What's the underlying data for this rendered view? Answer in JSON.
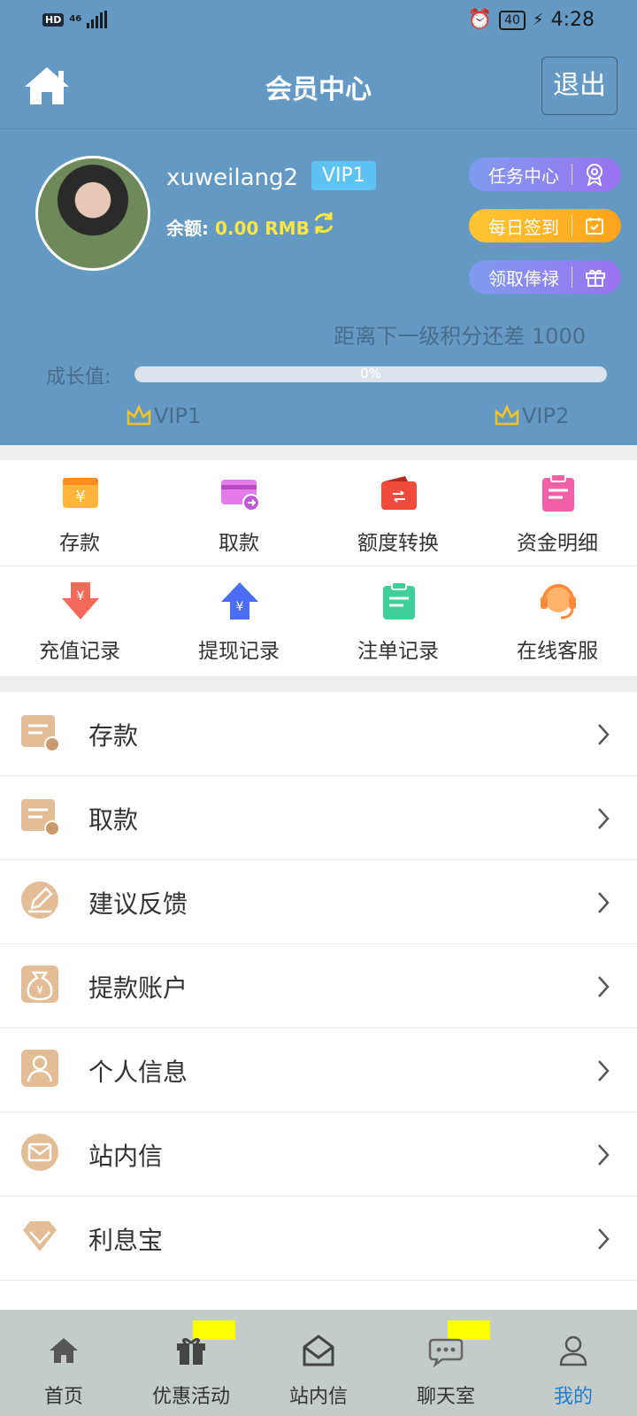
{
  "status_bar": {
    "hd": "HD",
    "network": "46",
    "battery": "40",
    "time": "4:28"
  },
  "header": {
    "title": "会员中心",
    "logout_label": "退出"
  },
  "profile": {
    "username": "xuweilang2",
    "vip_level": "VIP1",
    "balance_label": "余额:",
    "balance_value": "0.00 RMB",
    "actions": [
      {
        "label": "任务中心"
      },
      {
        "label": "每日签到"
      },
      {
        "label": "领取俸禄"
      }
    ],
    "next_level_text": "距离下一级积分还差 1000",
    "growth_label": "成长值:",
    "progress_text": "0%",
    "progress_fraction": 0,
    "current_level": "VIP1",
    "next_level": "VIP2"
  },
  "quick_actions": [
    {
      "label": "存款",
      "icon": "wallet-yen-icon",
      "color": "#ff9f2e"
    },
    {
      "label": "取款",
      "icon": "card-withdraw-icon",
      "color": "#d85fe0"
    },
    {
      "label": "额度转换",
      "icon": "transfer-icon",
      "color": "#f04a3c"
    },
    {
      "label": "资金明细",
      "icon": "clipboard-detail-icon",
      "color": "#f05fa8"
    },
    {
      "label": "充值记录",
      "icon": "arrow-down-yen-icon",
      "color": "#f46a5a"
    },
    {
      "label": "提现记录",
      "icon": "arrow-up-yen-icon",
      "color": "#4a6ef2"
    },
    {
      "label": "注单记录",
      "icon": "clipboard-bet-icon",
      "color": "#3ecf9a"
    },
    {
      "label": "在线客服",
      "icon": "headset-icon",
      "color": "#ff8a3a"
    }
  ],
  "menu": [
    {
      "label": "存款",
      "icon": "deposit-icon"
    },
    {
      "label": "取款",
      "icon": "withdraw-icon"
    },
    {
      "label": "建议反馈",
      "icon": "pencil-icon"
    },
    {
      "label": "提款账户",
      "icon": "money-bag-icon"
    },
    {
      "label": "个人信息",
      "icon": "person-icon"
    },
    {
      "label": "站内信",
      "icon": "envelope-icon"
    },
    {
      "label": "利息宝",
      "icon": "diamond-icon"
    }
  ],
  "bottom_nav": [
    {
      "label": "首页",
      "icon": "home-icon"
    },
    {
      "label": "优惠活动",
      "icon": "gift-icon"
    },
    {
      "label": "站内信",
      "icon": "mail-open-icon"
    },
    {
      "label": "聊天室",
      "icon": "chat-bubble-icon"
    },
    {
      "label": "我的",
      "icon": "user-icon",
      "active": true
    }
  ],
  "colors": {
    "header_bg": "#6499c4",
    "accent_yellow": "#ffe640",
    "nav_active": "#1d7fd1",
    "nav_bg": "#c4ccc9"
  }
}
